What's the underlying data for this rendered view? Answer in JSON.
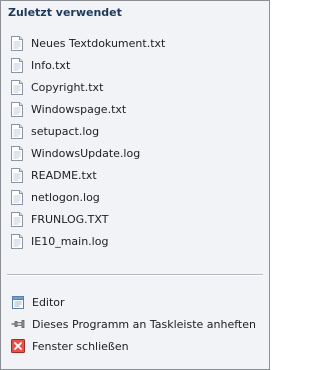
{
  "header": {
    "title": "Zuletzt verwendet"
  },
  "recent": {
    "items": [
      {
        "label": "Neues Textdokument.txt"
      },
      {
        "label": "Info.txt"
      },
      {
        "label": "Copyright.txt"
      },
      {
        "label": "Windowspage.txt"
      },
      {
        "label": "setupact.log"
      },
      {
        "label": "WindowsUpdate.log"
      },
      {
        "label": "README.txt"
      },
      {
        "label": "netlogon.log"
      },
      {
        "label": "FRUNLOG.TXT"
      },
      {
        "label": "IE10_main.log"
      }
    ]
  },
  "tasks": {
    "app_label": "Editor",
    "pin_label": "Dieses Programm an Taskleiste anheften",
    "close_label": "Fenster schließen"
  },
  "icons": {
    "file": "text-file-icon",
    "app": "notepad-icon",
    "pin": "pin-icon",
    "close": "close-window-icon"
  },
  "colors": {
    "header": "#1e395b",
    "close_icon": "#d9352b"
  }
}
